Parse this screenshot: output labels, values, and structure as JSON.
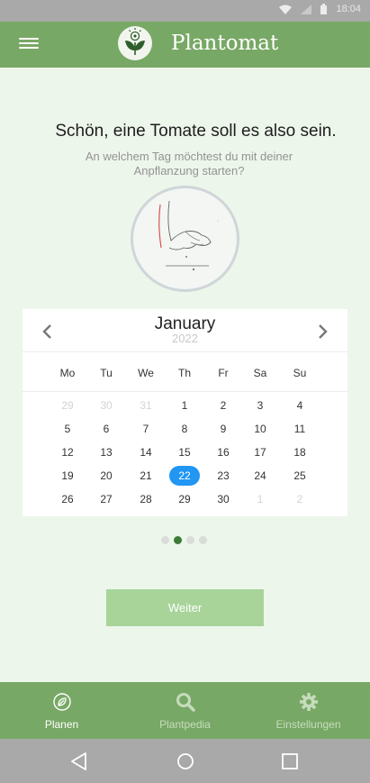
{
  "status_bar": {
    "time": "18:04"
  },
  "app_bar": {
    "title": "Plantomat",
    "menu_icon": "hamburger-menu-icon",
    "logo_icon": "plant-logo-icon"
  },
  "main": {
    "heading": "Schön, eine Tomate soll es also sein.",
    "subtext": "An welchem Tag möchtest du mit deiner Anpflanzung starten?",
    "illustration": "hand-planting-seed-illustration"
  },
  "calendar": {
    "month": "January",
    "year": "2022",
    "weekdays": [
      "Mo",
      "Tu",
      "We",
      "Th",
      "Fr",
      "Sa",
      "Su"
    ],
    "weeks": [
      [
        "29",
        "30",
        "31",
        "1",
        "2",
        "3",
        "4"
      ],
      [
        "5",
        "6",
        "7",
        "8",
        "9",
        "10",
        "11"
      ],
      [
        "12",
        "13",
        "14",
        "15",
        "16",
        "17",
        "18"
      ],
      [
        "19",
        "20",
        "21",
        "22",
        "23",
        "24",
        "25"
      ],
      [
        "26",
        "27",
        "28",
        "29",
        "30",
        "1",
        "2"
      ]
    ],
    "selected_day": "22"
  },
  "pager": {
    "total": 4,
    "active": 2
  },
  "actions": {
    "next_label": "Weiter"
  },
  "bottom_nav": {
    "items": [
      {
        "label": "Planen",
        "icon": "leaf-icon",
        "active": true
      },
      {
        "label": "Plantpedia",
        "icon": "search-icon",
        "active": false
      },
      {
        "label": "Einstellungen",
        "icon": "gear-icon",
        "active": false
      }
    ]
  },
  "colors": {
    "primary": "#78a865",
    "background": "#edf6eb",
    "selected": "#2196f3",
    "button": "#a8d49a",
    "active_dot": "#3c7a37"
  }
}
